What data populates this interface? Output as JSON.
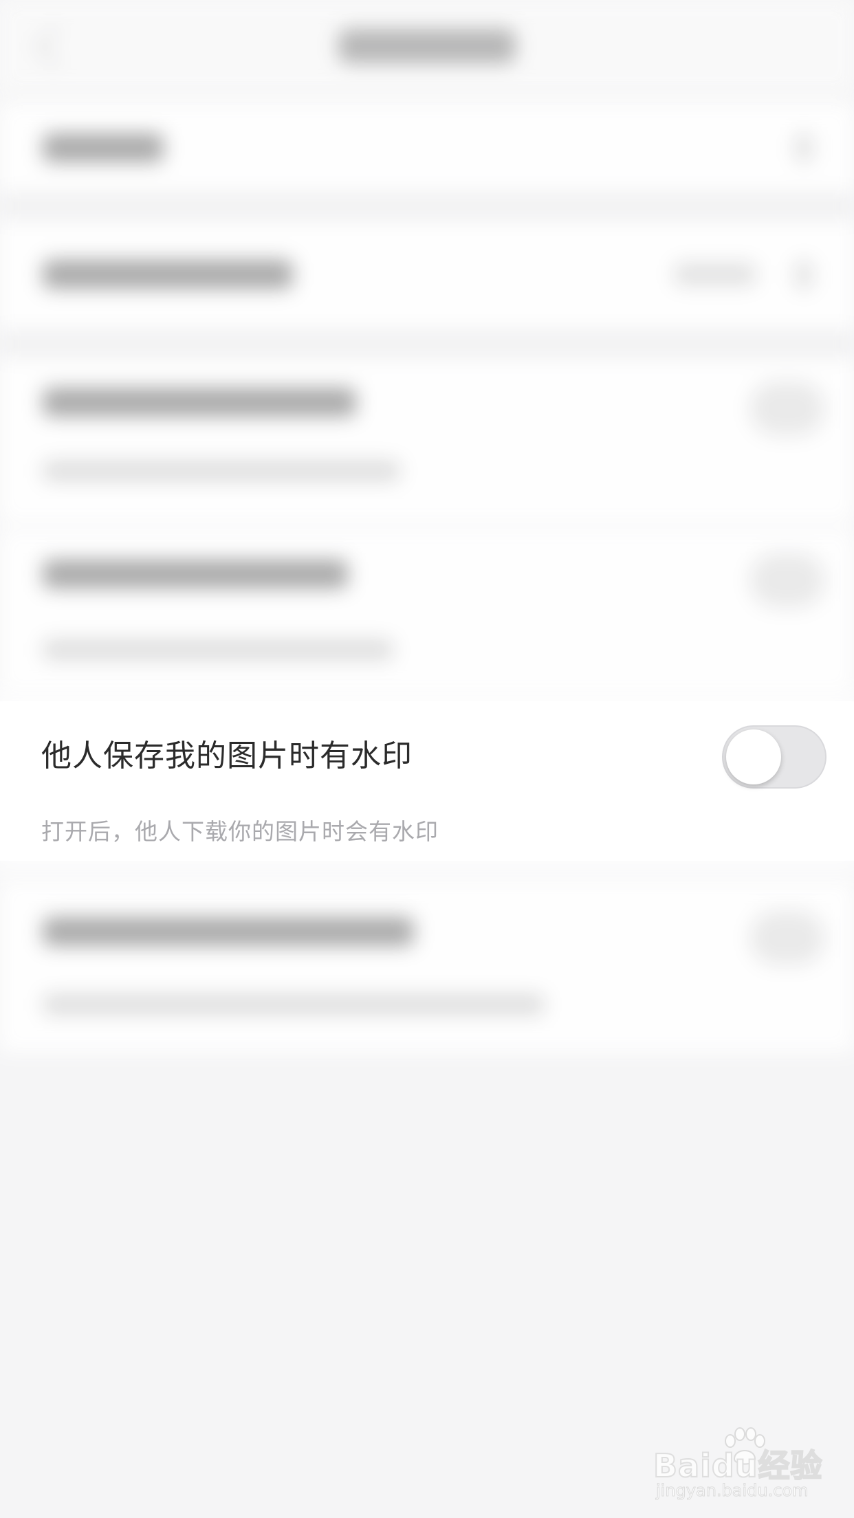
{
  "setting": {
    "title": "他人保存我的图片时有水印",
    "description": "打开后，他人下载你的图片时会有水印",
    "toggle_on": false
  },
  "watermark": {
    "logo": "Baidu经验",
    "url": "jingyan.baidu.com"
  },
  "icons": {
    "back": "chevron-left-icon",
    "chevron": "chevron-right-icon",
    "toggle": "toggle-switch-icon",
    "paw": "baidu-paw-icon"
  },
  "colors": {
    "title_text": "#2b2b2b",
    "description_text": "#a9a9ad",
    "toggle_track": "#e6e6e8",
    "background": "#f5f5f6"
  }
}
